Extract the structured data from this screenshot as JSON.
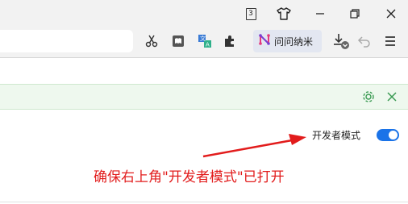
{
  "titlebar": {
    "tab_count": "3",
    "icons": [
      "tab-counter-icon",
      "tshirt-skin-icon",
      "minimize-icon",
      "restore-icon",
      "close-icon"
    ]
  },
  "toolbar": {
    "extensions": [
      "scissors-icon",
      "reader-icon",
      "translate-icon",
      "puzzle-extension-icon"
    ],
    "ext_pill_label": "问问纳米",
    "right_icons": [
      "download-icon",
      "undo-icon",
      "menu-icon"
    ]
  },
  "infobar": {
    "icons": [
      "settings-gear-icon",
      "close-icon"
    ]
  },
  "devmode": {
    "label": "开发者模式",
    "enabled": true
  },
  "annotation": {
    "text": "确保右上角\"开发者模式\"已打开",
    "color": "#e21c1c"
  },
  "colors": {
    "chrome_bg": "#f2f2f2",
    "toggle_on": "#1a73e8",
    "infobar_bg": "#eef8ee",
    "infobar_icon": "#3a9a52",
    "annotation": "#e21c1c"
  }
}
